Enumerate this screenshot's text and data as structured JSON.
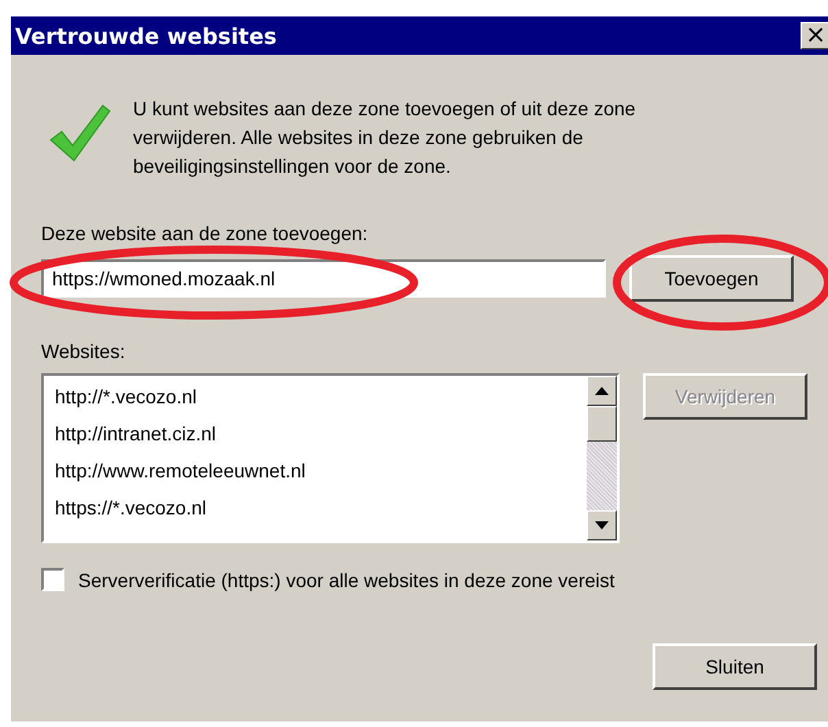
{
  "window": {
    "title": "Vertrouwde websites",
    "close": "×"
  },
  "intro": "U kunt websites aan deze zone toevoegen of uit deze zone verwijderen. Alle websites in deze zone gebruiken de beveiligingsinstellingen voor de zone.",
  "add_label": "Deze website aan de zone toevoegen:",
  "add_field": {
    "value": "https://wmoned.mozaak.nl"
  },
  "add_button": {
    "label": "Toevoegen",
    "disabled": false
  },
  "websites_label": "Websites:",
  "websites": [
    {
      "label": "http://*.vecozo.nl",
      "selected": false
    },
    {
      "label": "http://intranet.ciz.nl",
      "selected": false
    },
    {
      "label": "http://www.remoteleeuwnet.nl",
      "selected": false
    },
    {
      "label": "https://*.vecozo.nl",
      "selected": false
    }
  ],
  "remove_button": {
    "label": "Verwijderen",
    "disabled": true
  },
  "https_check": {
    "label": "Serververificatie (https:) voor alle websites in deze zone vereist",
    "checked": false
  },
  "close_button": {
    "label": "Sluiten",
    "disabled": false
  }
}
